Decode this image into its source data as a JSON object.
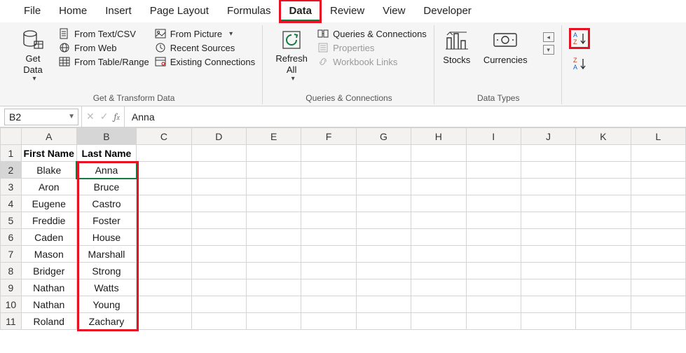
{
  "tabs": {
    "file": "File",
    "home": "Home",
    "insert": "Insert",
    "page_layout": "Page Layout",
    "formulas": "Formulas",
    "data": "Data",
    "review": "Review",
    "view": "View",
    "developer": "Developer"
  },
  "ribbon": {
    "get_data": "Get\nData",
    "from_text": "From Text/CSV",
    "from_web": "From Web",
    "from_table": "From Table/Range",
    "from_picture": "From Picture",
    "recent_sources": "Recent Sources",
    "existing_conn": "Existing Connections",
    "group1_label": "Get & Transform Data",
    "refresh_all": "Refresh\nAll",
    "queries": "Queries & Connections",
    "properties": "Properties",
    "workbook_links": "Workbook Links",
    "group2_label": "Queries & Connections",
    "stocks": "Stocks",
    "currencies": "Currencies",
    "group3_label": "Data Types",
    "sort_asc": "A→Z",
    "sort_desc": "Z→A"
  },
  "namebox": {
    "value": "B2"
  },
  "formula": {
    "value": "Anna"
  },
  "columns": [
    "A",
    "B",
    "C",
    "D",
    "E",
    "F",
    "G",
    "H",
    "I",
    "J",
    "K",
    "L"
  ],
  "header_row": {
    "a": "First Name",
    "b": "Last Name"
  },
  "rows": [
    {
      "n": "1"
    },
    {
      "n": "2",
      "a": "Blake",
      "b": "Anna"
    },
    {
      "n": "3",
      "a": "Aron",
      "b": "Bruce"
    },
    {
      "n": "4",
      "a": "Eugene",
      "b": "Castro"
    },
    {
      "n": "5",
      "a": "Freddie",
      "b": "Foster"
    },
    {
      "n": "6",
      "a": "Caden",
      "b": "House"
    },
    {
      "n": "7",
      "a": "Mason",
      "b": "Marshall"
    },
    {
      "n": "8",
      "a": "Bridger",
      "b": "Strong"
    },
    {
      "n": "9",
      "a": "Nathan",
      "b": "Watts"
    },
    {
      "n": "10",
      "a": "Nathan",
      "b": "Young"
    },
    {
      "n": "11",
      "a": "Roland",
      "b": "Zachary"
    }
  ]
}
